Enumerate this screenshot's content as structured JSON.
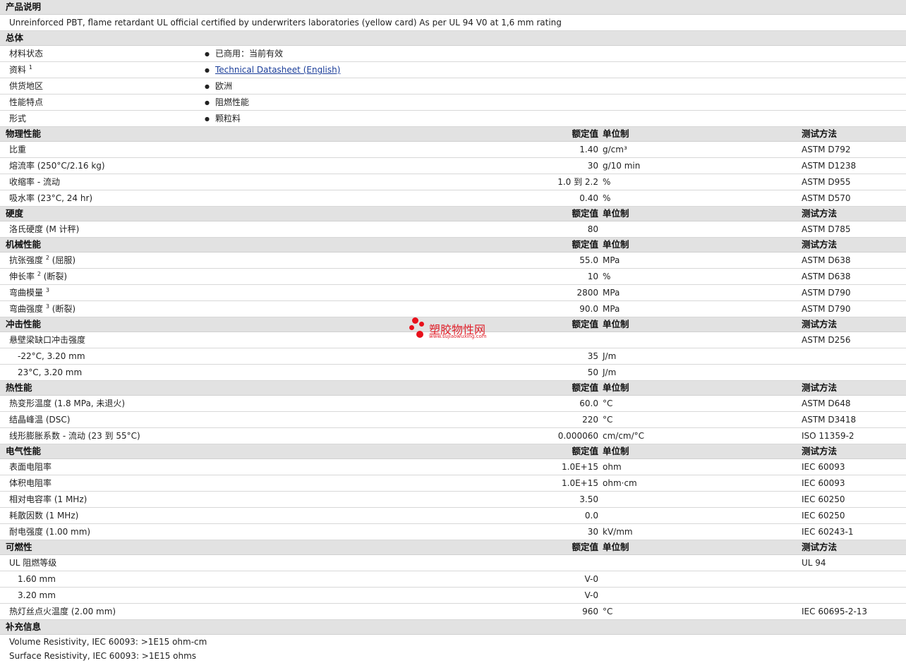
{
  "desc": {
    "title": "产品说明",
    "text": "Unreinforced PBT, flame retardant UL official certified by underwriters laboratories (yellow card) As per UL 94 V0 at 1,6 mm rating"
  },
  "general": {
    "title": "总体",
    "rows": [
      {
        "name": "材料状态",
        "sup": "",
        "value": "已商用：当前有效",
        "link": false
      },
      {
        "name": "资料",
        "sup": "1",
        "value": "Technical Datasheet (English)",
        "link": true
      },
      {
        "name": "供货地区",
        "sup": "",
        "value": "欧洲",
        "link": false
      },
      {
        "name": "性能特点",
        "sup": "",
        "value": "阻燃性能",
        "link": false
      },
      {
        "name": "形式",
        "sup": "",
        "value": "颗粒料",
        "link": false
      }
    ]
  },
  "col_labels": {
    "value": "额定值",
    "unit": "单位制",
    "test": "测试方法"
  },
  "sections": [
    {
      "title": "物理性能",
      "rows": [
        {
          "name": "比重",
          "sup": "",
          "after": "",
          "value": "1.40",
          "unit": "g/cm³",
          "test": "ASTM D792",
          "indent": false
        },
        {
          "name": "熔流率 (250°C/2.16 kg)",
          "sup": "",
          "after": "",
          "value": "30",
          "unit": "g/10 min",
          "test": "ASTM D1238",
          "indent": false
        },
        {
          "name": "收缩率 - 流动",
          "sup": "",
          "after": "",
          "value": "1.0 到  2.2",
          "unit": "%",
          "test": "ASTM D955",
          "indent": false
        },
        {
          "name": "吸水率 (23°C, 24 hr)",
          "sup": "",
          "after": "",
          "value": "0.40",
          "unit": "%",
          "test": "ASTM D570",
          "indent": false
        }
      ]
    },
    {
      "title": "硬度",
      "rows": [
        {
          "name": "洛氏硬度 (M 计秤)",
          "sup": "",
          "after": "",
          "value": "80",
          "unit": "",
          "test": "ASTM D785",
          "indent": false
        }
      ]
    },
    {
      "title": "机械性能",
      "rows": [
        {
          "name": "抗张强度",
          "sup": "2",
          "after": " (屈服)",
          "value": "55.0",
          "unit": "MPa",
          "test": "ASTM D638",
          "indent": false
        },
        {
          "name": "伸长率",
          "sup": "2",
          "after": " (断裂)",
          "value": "10",
          "unit": "%",
          "test": "ASTM D638",
          "indent": false
        },
        {
          "name": "弯曲模量",
          "sup": "3",
          "after": "",
          "value": "2800",
          "unit": "MPa",
          "test": "ASTM D790",
          "indent": false
        },
        {
          "name": "弯曲强度",
          "sup": "3",
          "after": " (断裂)",
          "value": "90.0",
          "unit": "MPa",
          "test": "ASTM D790",
          "indent": false
        }
      ]
    },
    {
      "title": "冲击性能",
      "rows": [
        {
          "name": "悬壁梁缺口冲击强度",
          "sup": "",
          "after": "",
          "value": "",
          "unit": "",
          "test": "ASTM D256",
          "indent": false
        },
        {
          "name": "-22°C, 3.20 mm",
          "sup": "",
          "after": "",
          "value": "35",
          "unit": "J/m",
          "test": "",
          "indent": true
        },
        {
          "name": "23°C, 3.20 mm",
          "sup": "",
          "after": "",
          "value": "50",
          "unit": "J/m",
          "test": "",
          "indent": true
        }
      ]
    },
    {
      "title": "热性能",
      "rows": [
        {
          "name": "热变形温度 (1.8 MPa, 未退火)",
          "sup": "",
          "after": "",
          "value": "60.0",
          "unit": "°C",
          "test": "ASTM D648",
          "indent": false
        },
        {
          "name": "结晶峰温 (DSC)",
          "sup": "",
          "after": "",
          "value": "220",
          "unit": "°C",
          "test": "ASTM D3418",
          "indent": false
        },
        {
          "name": "线形膨胀系数 - 流动 (23 到  55°C)",
          "sup": "",
          "after": "",
          "value": "0.000060",
          "unit": "cm/cm/°C",
          "test": "ISO 11359-2",
          "indent": false
        }
      ]
    },
    {
      "title": "电气性能",
      "rows": [
        {
          "name": "表面电阻率",
          "sup": "",
          "after": "",
          "value": "1.0E+15",
          "unit": "ohm",
          "test": "IEC 60093",
          "indent": false
        },
        {
          "name": "体积电阻率",
          "sup": "",
          "after": "",
          "value": "1.0E+15",
          "unit": "ohm·cm",
          "test": "IEC 60093",
          "indent": false
        },
        {
          "name": "相对电容率 (1 MHz)",
          "sup": "",
          "after": "",
          "value": "3.50",
          "unit": "",
          "test": "IEC 60250",
          "indent": false
        },
        {
          "name": "耗散因数 (1 MHz)",
          "sup": "",
          "after": "",
          "value": "0.0",
          "unit": "",
          "test": "IEC 60250",
          "indent": false
        },
        {
          "name": "耐电强度 (1.00 mm)",
          "sup": "",
          "after": "",
          "value": "30",
          "unit": "kV/mm",
          "test": "IEC 60243-1",
          "indent": false
        }
      ]
    },
    {
      "title": "可燃性",
      "rows": [
        {
          "name": "UL 阻燃等级",
          "sup": "",
          "after": "",
          "value": "",
          "unit": "",
          "test": "UL 94",
          "indent": false
        },
        {
          "name": "1.60 mm",
          "sup": "",
          "after": "",
          "value": "V-0",
          "unit": "",
          "test": "",
          "indent": true
        },
        {
          "name": "3.20 mm",
          "sup": "",
          "after": "",
          "value": "V-0",
          "unit": "",
          "test": "",
          "indent": true
        },
        {
          "name": "热灯丝点火温度 (2.00 mm)",
          "sup": "",
          "after": "",
          "value": "960",
          "unit": "°C",
          "test": "IEC 60695-2-13",
          "indent": false
        }
      ]
    }
  ],
  "supplement": {
    "title": "补充信息",
    "lines": [
      "Volume Resistivity, IEC 60093: >1E15 ohm-cm",
      "Surface Resistivity, IEC 60093: >1E15 ohms"
    ]
  },
  "watermark": {
    "title": "塑胶物性网",
    "url": "www.sujiaowuxing.com",
    "color": "#e8101b"
  }
}
